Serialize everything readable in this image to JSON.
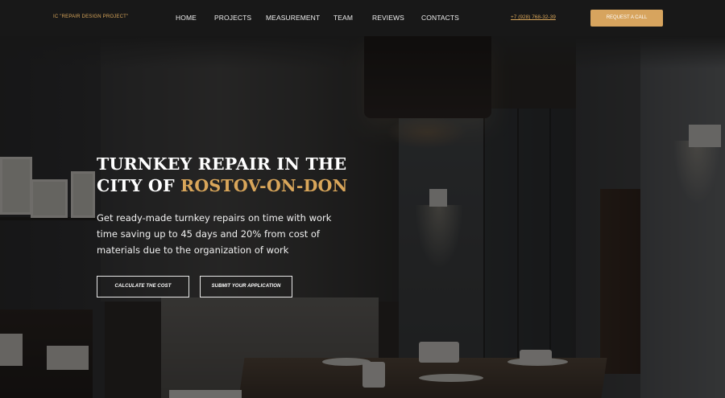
{
  "header": {
    "logo_text": "IC \"REPAIR DESIGN PROJECT\"",
    "nav": [
      {
        "label": "HOME"
      },
      {
        "label": "PROJECTS"
      },
      {
        "label": "MEASUREMENT"
      },
      {
        "label": "TEAM"
      },
      {
        "label": "REVIEWS"
      },
      {
        "label": "CONTACTS"
      }
    ],
    "phone": "+7 (928) 768-32-39",
    "cta_label": "REQUEST A CALL"
  },
  "hero": {
    "title_line1": "TURNKEY REPAIR IN THE",
    "title_line2_prefix": "CITY OF ",
    "title_line2_accent": "ROSTOV-ON-DON",
    "description": "Get ready-made turnkey repairs on time with work time saving up to 45 days and 20% from cost of materials due to the organization of work",
    "buttons": {
      "calculate_label": "CALCULATE THE COST",
      "submit_label": "SUBMIT YOUR APPLICATION"
    }
  },
  "colors": {
    "accent": "#d9a65a",
    "header_bg": "#181818",
    "cta_bg": "#d7a45e",
    "text": "#ffffff"
  }
}
